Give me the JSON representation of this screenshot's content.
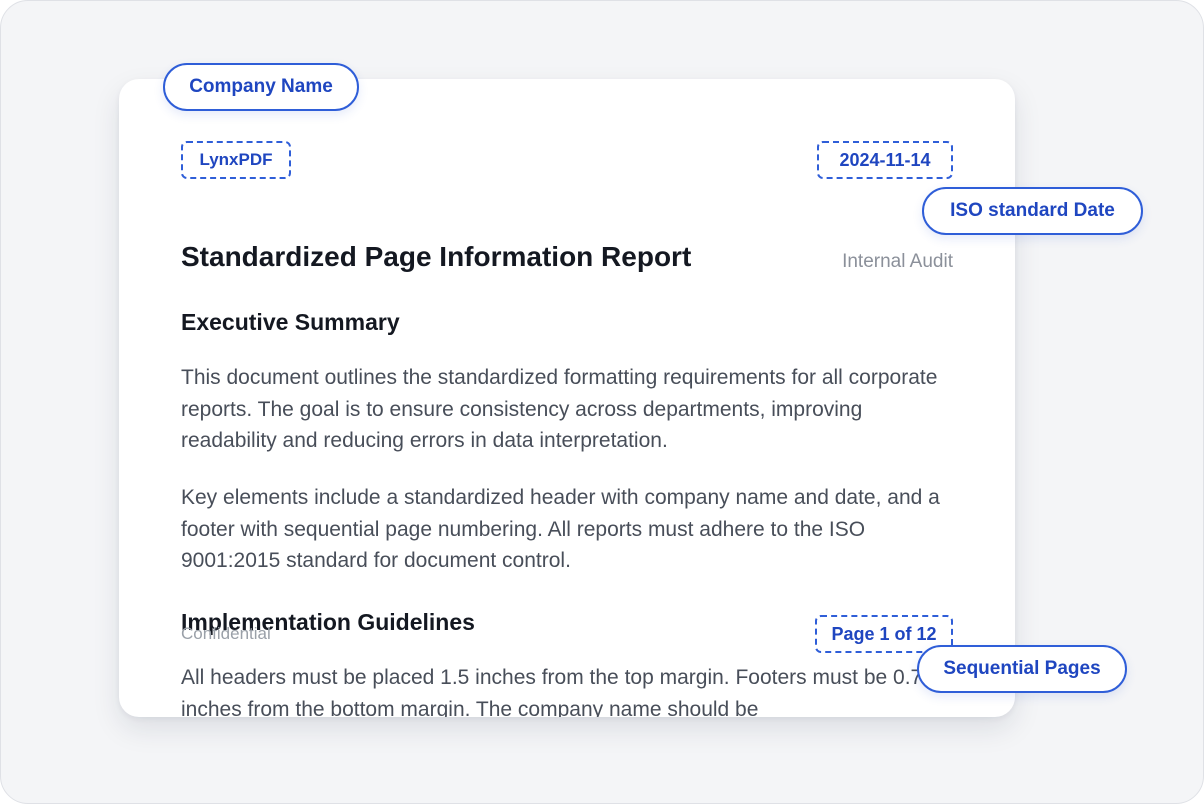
{
  "header": {
    "company": "LynxPDF",
    "date": "2024-11-14"
  },
  "document": {
    "title": "Standardized Page Information Report",
    "subtitle": "Internal Audit",
    "sections": [
      {
        "heading": "Executive Summary",
        "paragraphs": [
          "This document outlines the standardized formatting requirements for all corporate reports. The goal is to ensure consistency across departments, improving readability and reducing errors in data interpretation.",
          "Key elements include a standardized header with company name and date, and a footer with sequential page numbering. All reports must adhere to the ISO 9001:2015 standard for document control."
        ]
      },
      {
        "heading": "Implementation Guidelines",
        "paragraphs": [
          "All headers must be placed 1.5 inches from the top margin. Footers must be 0.75 inches from the bottom margin. The company name should be"
        ]
      }
    ]
  },
  "footer": {
    "label": "Confidential",
    "page": "Page 1 of 12"
  },
  "annotations": {
    "company": "Company Name",
    "date": "ISO standard Date",
    "pages": "Sequential Pages"
  },
  "colors": {
    "accent": "#2f5ed8",
    "accent_text": "#1f46c0",
    "heading": "#141821",
    "body": "#484e59",
    "muted": "#8b909a",
    "background": "#f4f5f7"
  }
}
